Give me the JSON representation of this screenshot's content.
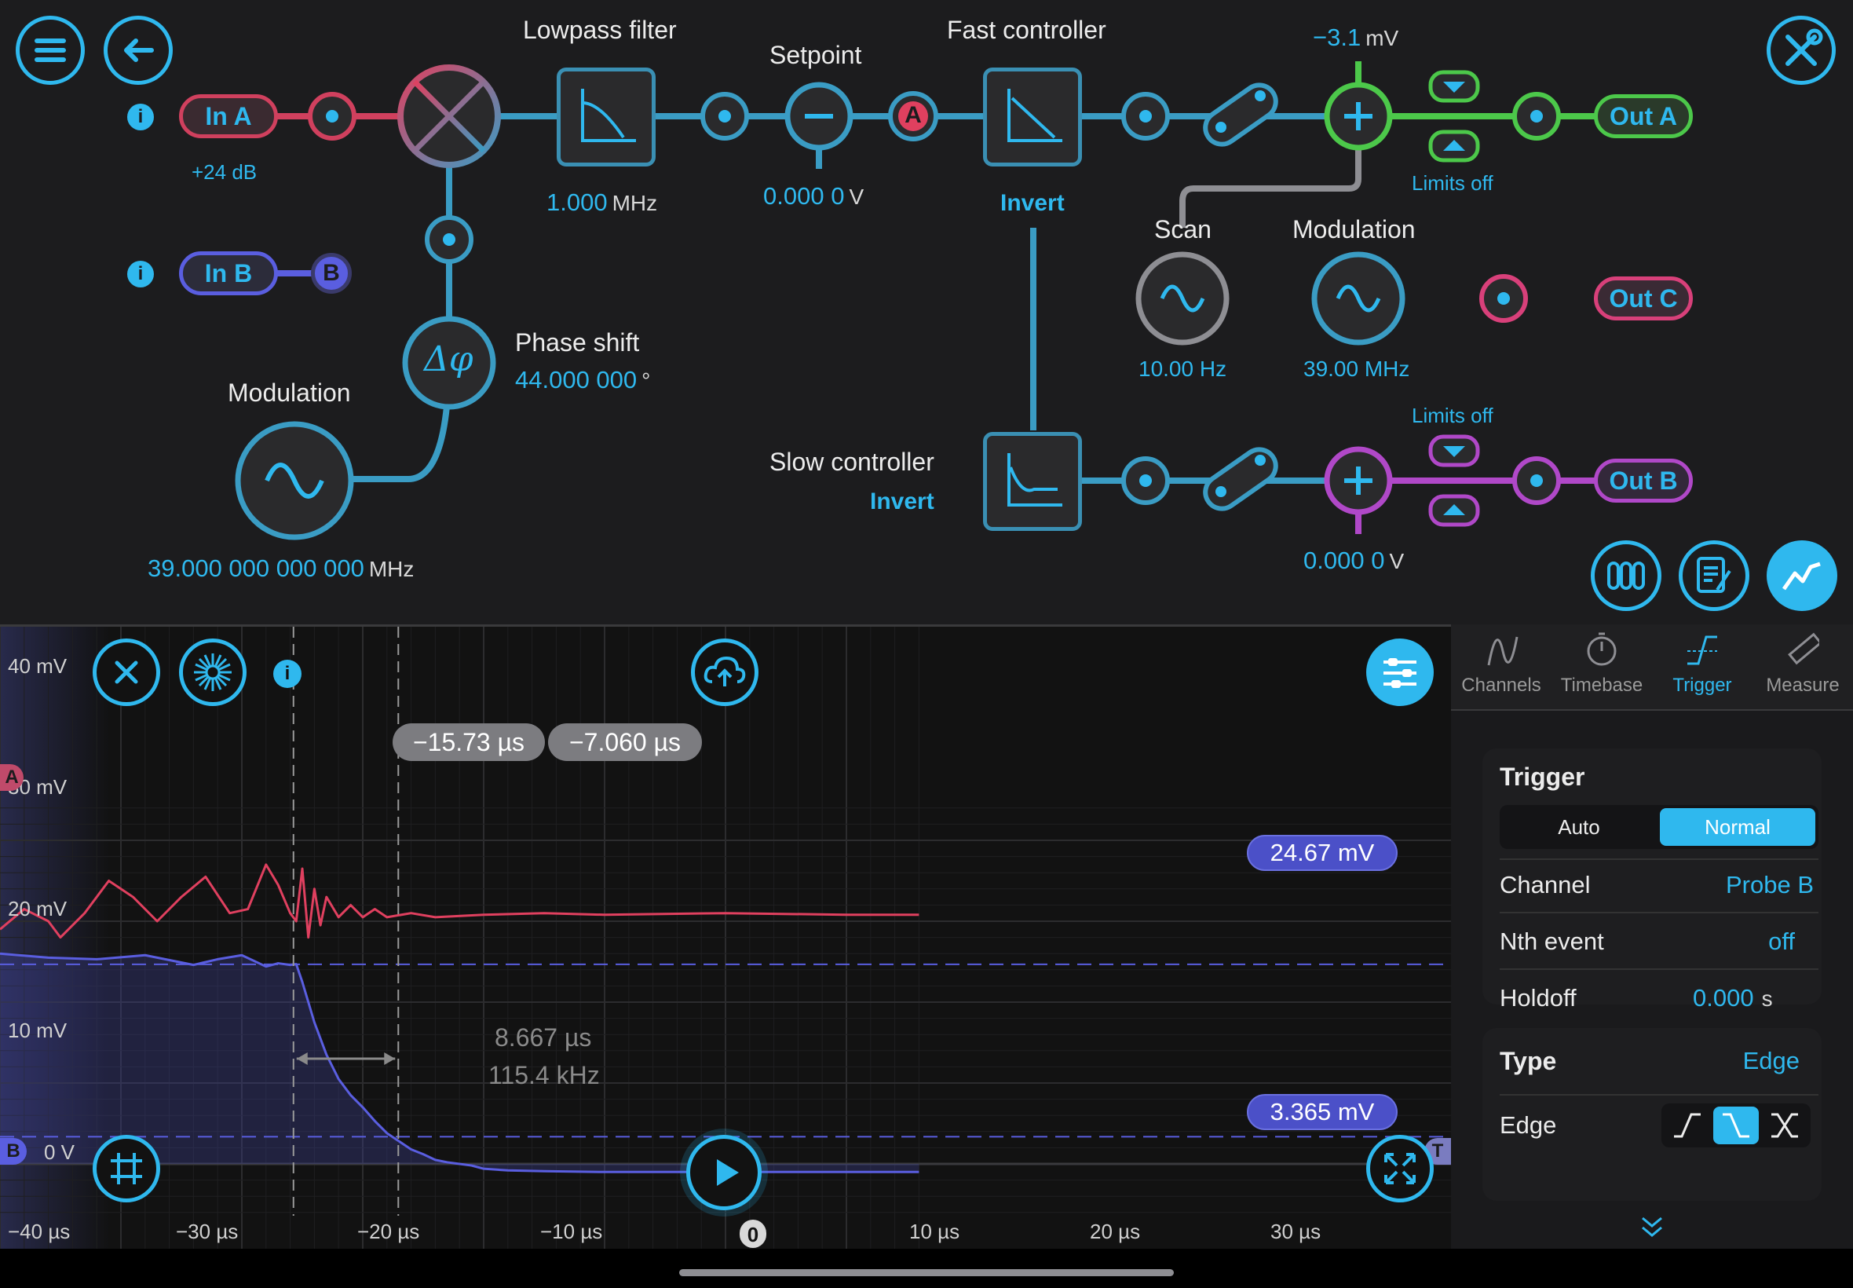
{
  "fpga": {
    "in_a": {
      "label": "In A",
      "gain": "+24 dB"
    },
    "in_b": {
      "label": "In B",
      "badge": "B"
    },
    "lowpass": {
      "title": "Lowpass filter",
      "value": "1.000",
      "unit": "MHz"
    },
    "setpoint": {
      "title": "Setpoint",
      "value": "0.000 0",
      "unit": "V",
      "badge": "A"
    },
    "fast_controller": {
      "title": "Fast controller",
      "invert": "Invert"
    },
    "slow_controller": {
      "title": "Slow controller",
      "invert": "Invert"
    },
    "phase_shift": {
      "title": "Phase shift",
      "value": "44.000 000",
      "unit": "°"
    },
    "modulation_in": {
      "title": "Modulation",
      "value": "39.000 000 000 000",
      "unit": "MHz"
    },
    "offset_a": {
      "value": "−3.1",
      "unit": "mV"
    },
    "limits_a": "Limits off",
    "limits_b": "Limits off",
    "scan": {
      "title": "Scan",
      "value": "10.00 Hz"
    },
    "modulation_out": {
      "title": "Modulation",
      "value": "39.00 MHz"
    },
    "offset_b": {
      "value": "0.000 0",
      "unit": "V"
    },
    "out_a": "Out A",
    "out_b": "Out B",
    "out_c": "Out C",
    "colors": {
      "accent": "#2fb8ee",
      "in_a": "#e0405f",
      "in_b": "#5a5ee0",
      "out_a": "#4cc84a",
      "out_b": "#b048c8",
      "out_c": "#d8407a",
      "grey": "#8e8e93"
    }
  },
  "scope": {
    "tabs": [
      {
        "label": "Channels",
        "icon": "sine-icon",
        "active": false
      },
      {
        "label": "Timebase",
        "icon": "stopwatch-icon",
        "active": false
      },
      {
        "label": "Trigger",
        "icon": "trigger-edge-icon",
        "active": true
      },
      {
        "label": "Measure",
        "icon": "ruler-icon",
        "active": false
      }
    ],
    "trigger": {
      "title": "Trigger",
      "mode_options": [
        "Auto",
        "Normal"
      ],
      "mode_selected": "Normal",
      "channel_label": "Channel",
      "channel_value": "Probe B",
      "nth_label": "Nth event",
      "nth_value": "off",
      "holdoff_label": "Holdoff",
      "holdoff_value": "0.000",
      "holdoff_unit": "s"
    },
    "type": {
      "title": "Type",
      "value": "Edge",
      "edge_label": "Edge",
      "edge_selected": "falling"
    },
    "cursors": {
      "t1": "−15.73 µs",
      "t2": "−7.060 µs",
      "dt": "8.667 µs",
      "freq": "115.4 kHz"
    },
    "levels": {
      "upper": "24.67 mV",
      "lower": "3.365 mV"
    },
    "trigger_marker": "0",
    "channel_markers": {
      "a": "A",
      "b": "B",
      "t": "T"
    }
  },
  "chart_data": {
    "type": "line",
    "title": "",
    "xlabel": "",
    "ylabel": "",
    "x_ticks": [
      "−40 µs",
      "−30 µs",
      "−20 µs",
      "−10 µs",
      "0",
      "10 µs",
      "20 µs",
      "30 µs"
    ],
    "y_ticks": [
      "40 mV",
      "30 mV",
      "20 mV",
      "10 mV",
      "0 V"
    ],
    "xlim": [
      -40,
      36
    ],
    "ylim": [
      -7,
      44
    ],
    "grid": true,
    "series": [
      {
        "name": "A",
        "color": "#e0405f",
        "x": [
          -40,
          -38,
          -36,
          -35,
          -33,
          -31,
          -29,
          -27,
          -25,
          -23,
          -21,
          -19.5,
          -18,
          -17,
          -16,
          -15.5,
          -15,
          -14.5,
          -14,
          -13.5,
          -13,
          -12,
          -11,
          -10,
          -9,
          -8,
          -6,
          -4,
          0,
          5,
          10,
          20,
          30,
          36
        ],
        "y": [
          29,
          31.5,
          30,
          28,
          31,
          35,
          33,
          30,
          33,
          35.5,
          31,
          31.5,
          37,
          34.5,
          31,
          30,
          36.5,
          28,
          34,
          29.5,
          33,
          30.5,
          32,
          30.5,
          31.5,
          30.5,
          31,
          30.5,
          30.8,
          31,
          30.8,
          31,
          30.8,
          30.8
        ]
      },
      {
        "name": "B",
        "color": "#5a5ee0",
        "x": [
          -40,
          -36,
          -32,
          -28,
          -24,
          -22,
          -20,
          -18,
          -17,
          -16,
          -15.5,
          -15,
          -14,
          -13,
          -12,
          -11,
          -10,
          -9,
          -8,
          -7,
          -6,
          -5,
          -4,
          -3,
          -2,
          -1,
          0,
          2,
          5,
          10,
          20,
          30,
          36
        ],
        "y": [
          26,
          25.5,
          25.3,
          25.8,
          24.6,
          25.3,
          25.8,
          24.4,
          24.8,
          24.6,
          24.7,
          22.5,
          17.5,
          13.5,
          10.5,
          8.5,
          7,
          5.3,
          3.8,
          2.8,
          1.8,
          1.2,
          0.5,
          0.2,
          0,
          -0.2,
          -0.6,
          -0.8,
          -0.9,
          -1,
          -1,
          -1,
          -1
        ]
      }
    ],
    "levels": [
      24.67,
      3.365
    ],
    "cursors_x": [
      -15.73,
      -7.06
    ]
  }
}
